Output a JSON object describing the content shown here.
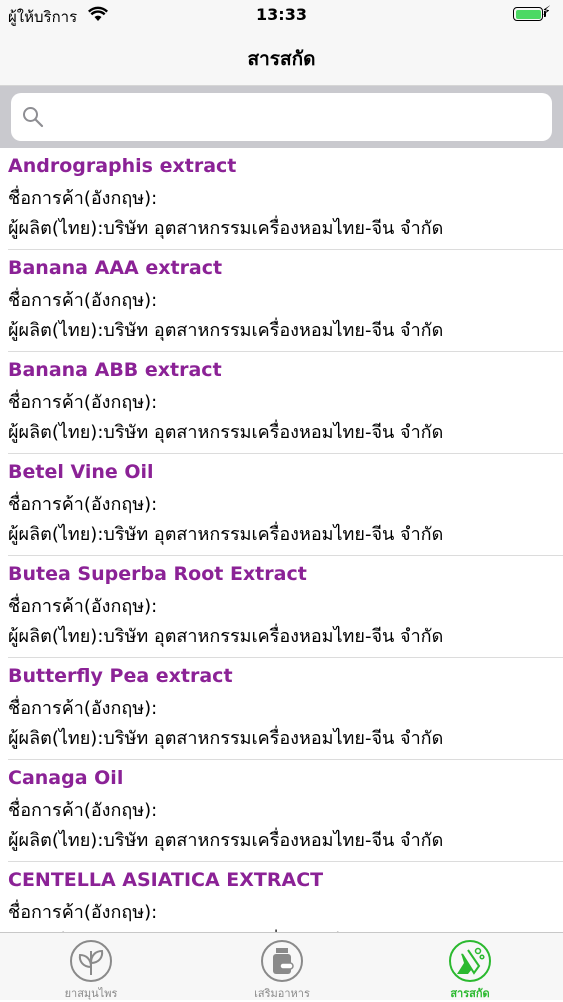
{
  "status": {
    "carrier": "ผู้ให้บริการ",
    "time": "13:33",
    "battery_color": "#4cd964"
  },
  "nav": {
    "title": "สารสกัด"
  },
  "search": {
    "placeholder": "",
    "value": ""
  },
  "labels": {
    "trade_name": "ชื่อการค้า(อังกฤษ):",
    "maker": "ผู้ผลิต(ไทย):บริษัท อุตสาหกรรมเครื่องหอมไทย-จีน จำกัด"
  },
  "items": [
    {
      "name": "Andrographis extract",
      "trade": "ชื่อการค้า(อังกฤษ):",
      "maker": "ผู้ผลิต(ไทย):บริษัท อุตสาหกรรมเครื่องหอมไทย-จีน จำกัด"
    },
    {
      "name": "Banana AAA extract",
      "trade": "ชื่อการค้า(อังกฤษ):",
      "maker": "ผู้ผลิต(ไทย):บริษัท อุตสาหกรรมเครื่องหอมไทย-จีน จำกัด"
    },
    {
      "name": "Banana ABB extract",
      "trade": "ชื่อการค้า(อังกฤษ):",
      "maker": "ผู้ผลิต(ไทย):บริษัท อุตสาหกรรมเครื่องหอมไทย-จีน จำกัด"
    },
    {
      "name": "Betel Vine Oil",
      "trade": "ชื่อการค้า(อังกฤษ):",
      "maker": "ผู้ผลิต(ไทย):บริษัท อุตสาหกรรมเครื่องหอมไทย-จีน จำกัด"
    },
    {
      "name": "Butea Superba Root Extract",
      "trade": "ชื่อการค้า(อังกฤษ):",
      "maker": "ผู้ผลิต(ไทย):บริษัท อุตสาหกรรมเครื่องหอมไทย-จีน จำกัด"
    },
    {
      "name": "Butterfly Pea extract",
      "trade": "ชื่อการค้า(อังกฤษ):",
      "maker": "ผู้ผลิต(ไทย):บริษัท อุตสาหกรรมเครื่องหอมไทย-จีน จำกัด"
    },
    {
      "name": "Canaga Oil",
      "trade": "ชื่อการค้า(อังกฤษ):",
      "maker": "ผู้ผลิต(ไทย):บริษัท อุตสาหกรรมเครื่องหอมไทย-จีน จำกัด"
    },
    {
      "name": "CENTELLA ASIATICA EXTRACT",
      "trade": "ชื่อการค้า(อังกฤษ):",
      "maker": "ผู้ผลิต(ไทย):บริษัท อุตสาหกรรมเครื่องหอมไทย-จีน จำกัด"
    }
  ],
  "tabs": [
    {
      "label": "ยาสมุนไพร",
      "icon": "herb-leaf-icon",
      "active": false
    },
    {
      "label": "เสริมอาหาร",
      "icon": "supplement-bottle-icon",
      "active": false
    },
    {
      "label": "สารสกัด",
      "icon": "extract-flask-icon",
      "active": true
    }
  ],
  "colors": {
    "item_name": "#8b2296",
    "active_tab": "#2bb92f",
    "inactive_tab": "#8a8a8a"
  }
}
